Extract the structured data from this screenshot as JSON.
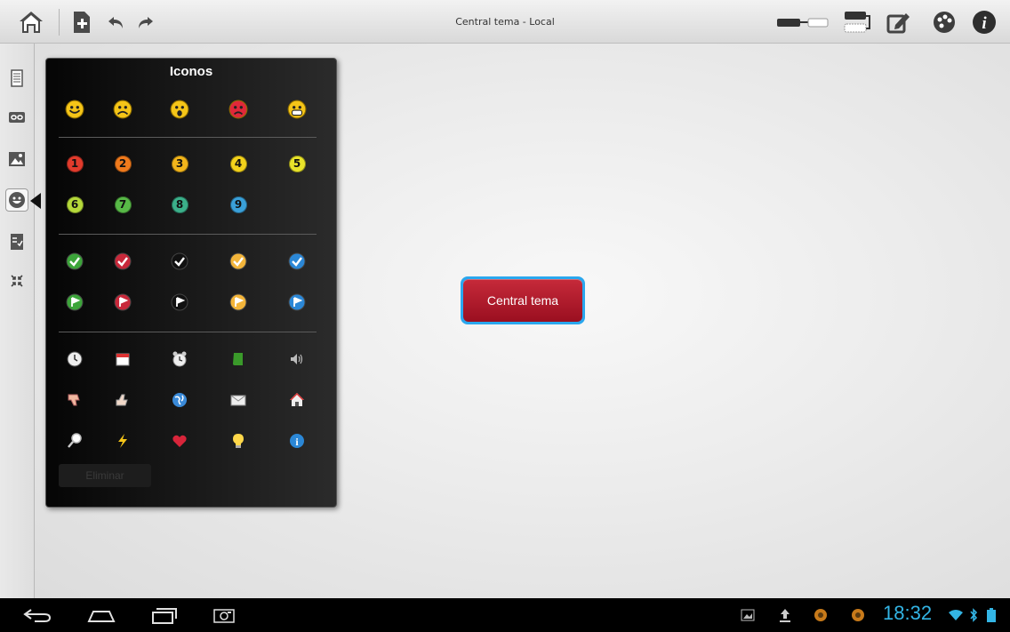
{
  "window": {
    "title": "Central tema - Local"
  },
  "panel": {
    "title": "Iconos",
    "delete_label": "Eliminar",
    "smileys": [
      "smiley-happy",
      "smiley-sad",
      "smiley-surprised",
      "smiley-angry",
      "smiley-grin"
    ],
    "numbers": [
      {
        "label": "1",
        "color": "#e23b2c"
      },
      {
        "label": "2",
        "color": "#f07a1c"
      },
      {
        "label": "3",
        "color": "#f2b51b"
      },
      {
        "label": "4",
        "color": "#f3d21b"
      },
      {
        "label": "5",
        "color": "#e8e32a"
      },
      {
        "label": "6",
        "color": "#b5d93a"
      },
      {
        "label": "7",
        "color": "#58b947"
      },
      {
        "label": "8",
        "color": "#3bb08a"
      },
      {
        "label": "9",
        "color": "#3aa0d9"
      }
    ],
    "checks": [
      "#3ca53a",
      "#c8283a",
      "#111111",
      "#f3b53a",
      "#2b87d6"
    ],
    "flags": [
      "#3ca53a",
      "#c8283a",
      "#111111",
      "#f3b53a",
      "#2b87d6"
    ],
    "misc": [
      "clock-icon",
      "calendar-icon",
      "alarm-icon",
      "book-icon",
      "speaker-icon",
      "thumbs-down-icon",
      "thumbs-up-icon",
      "globe-icon",
      "mail-icon",
      "home-icon",
      "magnifier-icon",
      "lightning-icon",
      "heart-icon",
      "lightbulb-icon",
      "info-icon"
    ]
  },
  "central_topic": {
    "label": "Central tema"
  },
  "status": {
    "time": "18:32"
  },
  "colors": {
    "accent": "#33b5e5",
    "topic_red": "#b21c2e",
    "topic_border": "#2aa7ee"
  }
}
